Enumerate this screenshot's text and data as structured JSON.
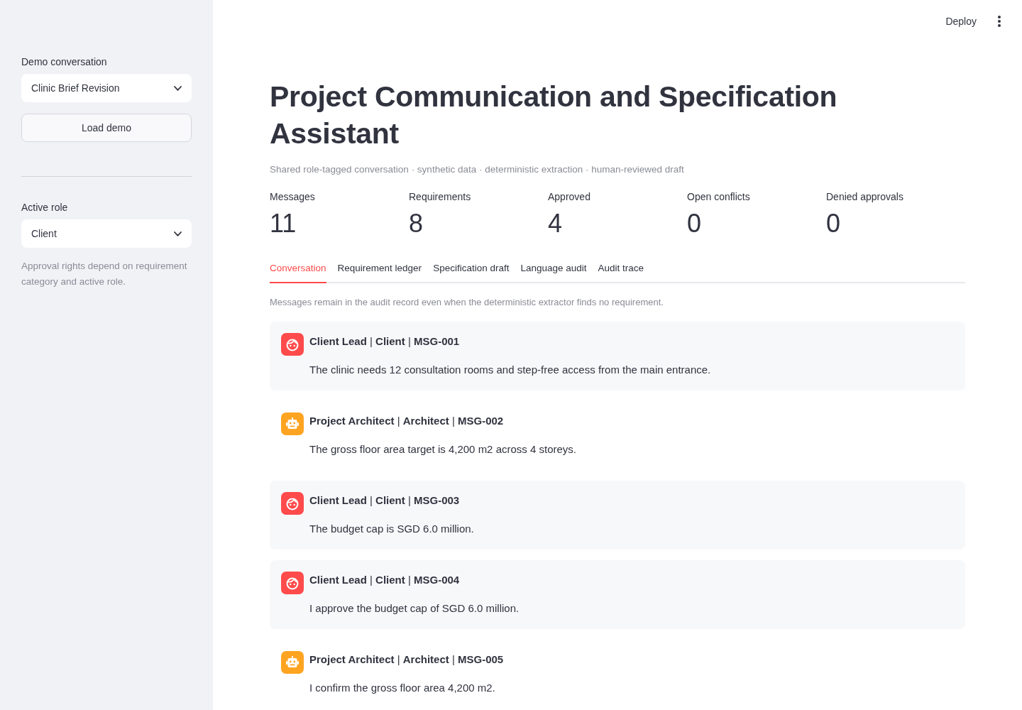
{
  "header": {
    "deploy": "Deploy"
  },
  "sidebar": {
    "conversation_select": {
      "label": "Demo conversation",
      "value": "Clinic Brief Revision"
    },
    "load_button": "Load demo",
    "role_select": {
      "label": "Active role",
      "value": "Client"
    },
    "caption": "Approval rights depend on requirement category and active role."
  },
  "title": "Project Communication and Specification Assistant",
  "subtitle": "Shared role-tagged conversation · synthetic data · deterministic extraction · human-reviewed draft",
  "metrics": [
    {
      "label": "Messages",
      "value": "11"
    },
    {
      "label": "Requirements",
      "value": "8"
    },
    {
      "label": "Approved",
      "value": "4"
    },
    {
      "label": "Open conflicts",
      "value": "0"
    },
    {
      "label": "Denied approvals",
      "value": "0"
    }
  ],
  "tabs": [
    {
      "label": "Conversation",
      "selected": true
    },
    {
      "label": "Requirement ledger",
      "selected": false
    },
    {
      "label": "Specification draft",
      "selected": false
    },
    {
      "label": "Language audit",
      "selected": false
    },
    {
      "label": "Audit trace",
      "selected": false
    }
  ],
  "tab_caption": "Messages remain in the audit record even when the deterministic extractor finds no requirement.",
  "messages": [
    {
      "kind": "client",
      "header": "**Client Lead** | **Client** | **MSG-001**",
      "text": "The clinic needs 12 consultation rooms and step-free access from the main entrance."
    },
    {
      "kind": "architect",
      "header": "**Project Architect** | **Architect** | **MSG-002**",
      "text": "The gross floor area target is 4,200 m2 across 4 storeys."
    },
    {
      "kind": "client",
      "header": "**Client Lead** | **Client** | **MSG-003**",
      "text": "The budget cap is SGD 6.0 million."
    },
    {
      "kind": "client",
      "header": "**Client Lead** | **Client** | **MSG-004**",
      "text": "I approve the budget cap of SGD 6.0 million."
    },
    {
      "kind": "architect",
      "header": "**Project Architect** | **Architect** | **MSG-005**",
      "text": "I confirm the gross floor area 4,200 m2."
    }
  ]
}
